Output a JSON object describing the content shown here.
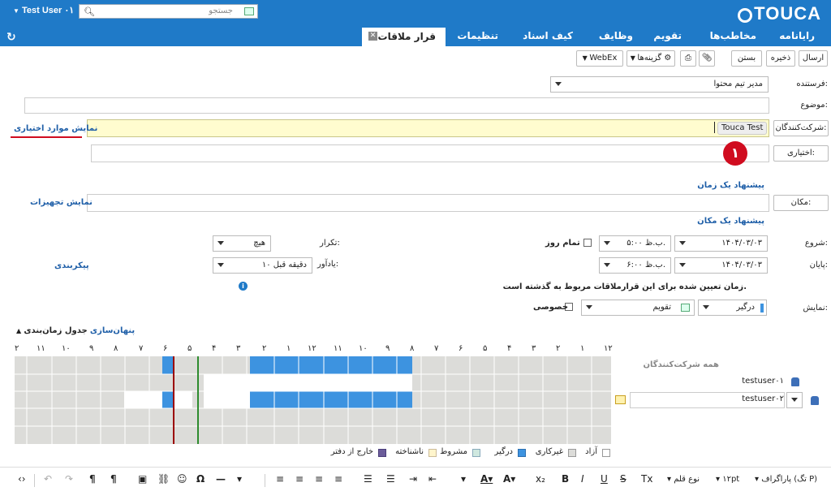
{
  "app": {
    "brand": "TOUCA",
    "user": "Test User ۰۱",
    "search_placeholder": "جستجو"
  },
  "nav": {
    "items": [
      "رایانامه",
      "مخاطب‌ها",
      "تقویم",
      "وظایف",
      "کیف اسناد",
      "تنظیمات"
    ],
    "active_tab": "قرار ملاقات"
  },
  "toolbar": {
    "send": "ارسال",
    "save": "ذخیره",
    "close": "بستن",
    "options": "گزینه‌ها",
    "webex": "WebEx"
  },
  "form": {
    "from_label": "فرستنده:",
    "from_value": "مدیر تیم محتوا",
    "subject_label": "موضوع:",
    "attendees_button": "شرکت‌کنندگان:",
    "attendee_chip": "Touca Test",
    "optional_button": "اختیاری:",
    "show_optional": "نمایش موارد اختیاری",
    "badge": "۱",
    "suggest_time": "پیشنهاد یک زمان",
    "location_button": "مکان:",
    "show_equipment": "نمایش تجهیزات",
    "suggest_location": "پیشنهاد یک مکان",
    "start_label": "شروع:",
    "start_date": "۱۴۰۴/۰۳/۰۳",
    "start_time": "۵:۰۰ ب.ظ.",
    "allday_label": "تمام روز",
    "end_label": "پایان:",
    "end_date": "۱۴۰۴/۰۳/۰۳",
    "end_time": "۶:۰۰ ب.ظ.",
    "repeat_label": "تکرار:",
    "repeat_value": "هیچ",
    "reminder_label": "یادآور:",
    "reminder_value": "۱۰ دقیقه قبل",
    "configure": "پیکربندی",
    "past_warning": "زمان تعیین شده برای این قرارملاقات مربوط به گذشته است.",
    "show_label": "نمایش:",
    "show_as_value": "درگیر",
    "calendar_value": "تقویم",
    "private_label": "خصوصی"
  },
  "scheduler": {
    "hide_link": "پنهان‌سازی",
    "title": "جدول زمان‌بندی",
    "hours": [
      "۱۲",
      "۱",
      "۲",
      "۳",
      "۴",
      "۵",
      "۶",
      "۷",
      "۸",
      "۹",
      "۱۰",
      "۱۱",
      "۱۲",
      "۱",
      "۲",
      "۳",
      "۴",
      "۵",
      "۶",
      "۷",
      "۸",
      "۹",
      "۱۰",
      "۱۱",
      "۲"
    ],
    "all_attendees": "همه شرکت‌کنندگان",
    "attendees": [
      "testuser۰۱",
      "testuser۰۲"
    ],
    "legend": [
      {
        "label": "آزاد",
        "color": "#ffffff"
      },
      {
        "label": "غیرکاری",
        "color": "#dcdcd9"
      },
      {
        "label": "درگیر",
        "color": "#3d93e0"
      },
      {
        "label": "مشروط",
        "color": "#cfe8df"
      },
      {
        "label": "ناشناخته",
        "color": "#fff5cc"
      },
      {
        "label": "خارج از دفتر",
        "color": "#6b5c9a"
      }
    ]
  },
  "editor": {
    "paragraph": "پاراگراف (تگ P)",
    "size": "۱۲pt",
    "font": "نوع قلم"
  },
  "colors": {
    "brand": "#1f7ac8",
    "busy": "#3d93e0",
    "nonwork": "#dcdcd9",
    "highlight": "#fffccf",
    "start_line": "#2e8b2e",
    "end_line": "#9b0000"
  }
}
